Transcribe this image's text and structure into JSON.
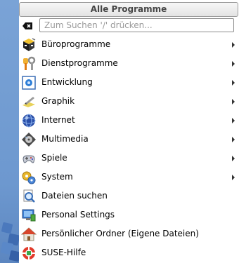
{
  "header": {
    "title": "Alle Programme"
  },
  "search": {
    "placeholder": "Zum Suchen '/' drücken..."
  },
  "menu": {
    "items": [
      {
        "label": "Büroprogramme",
        "submenu": true,
        "icon": "office-icon"
      },
      {
        "label": "Dienstprogramme",
        "submenu": true,
        "icon": "utilities-icon"
      },
      {
        "label": "Entwicklung",
        "submenu": true,
        "icon": "development-icon"
      },
      {
        "label": "Graphik",
        "submenu": true,
        "icon": "graphics-icon"
      },
      {
        "label": "Internet",
        "submenu": true,
        "icon": "internet-icon"
      },
      {
        "label": "Multimedia",
        "submenu": true,
        "icon": "multimedia-icon"
      },
      {
        "label": "Spiele",
        "submenu": true,
        "icon": "games-icon"
      },
      {
        "label": "System",
        "submenu": true,
        "icon": "system-icon"
      },
      {
        "label": "Dateien suchen",
        "submenu": false,
        "icon": "find-files-icon"
      },
      {
        "label": "Personal Settings",
        "submenu": false,
        "icon": "personal-settings-icon"
      },
      {
        "label": "Persönlicher Ordner (Eigene Dateien)",
        "submenu": false,
        "icon": "home-folder-icon"
      },
      {
        "label": "SUSE-Hilfe",
        "submenu": false,
        "icon": "help-icon"
      }
    ]
  }
}
